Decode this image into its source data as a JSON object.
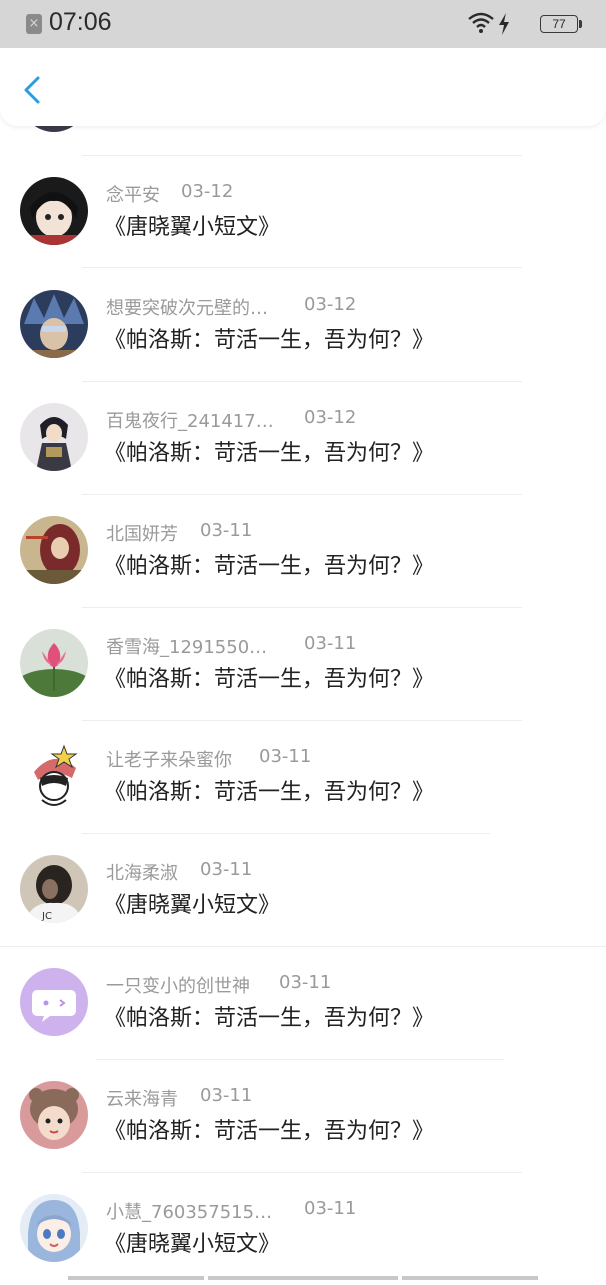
{
  "status_bar": {
    "time": "07:06",
    "battery": "77"
  },
  "header": {
    "back_icon": "chevron-left-icon",
    "accent": "#2a9de0"
  },
  "list": [
    {
      "name": "念平安",
      "date": "03-12",
      "title": "《唐晓翼小短文》"
    },
    {
      "name": "想要突破次元壁的…",
      "date": "03-12",
      "title": "《帕洛斯：苛活一生，吾为何？》"
    },
    {
      "name": "百鬼夜行_241417…",
      "date": "03-12",
      "title": "《帕洛斯：苛活一生，吾为何？》"
    },
    {
      "name": "北国妍芳",
      "date": "03-11",
      "title": "《帕洛斯：苛活一生，吾为何？》"
    },
    {
      "name": "香雪海_1291550…",
      "date": "03-11",
      "title": "《帕洛斯：苛活一生，吾为何？》"
    },
    {
      "name": "让老子来朵蜜你",
      "date": "03-11",
      "title": "《帕洛斯：苛活一生，吾为何？》"
    },
    {
      "name": "北海柔淑",
      "date": "03-11",
      "title": "《唐晓翼小短文》"
    },
    {
      "name": "一只变小的创世神",
      "date": "03-11",
      "title": "《帕洛斯：苛活一生，吾为何？》"
    },
    {
      "name": "云来海青",
      "date": "03-11",
      "title": "《帕洛斯：苛活一生，吾为何？》"
    },
    {
      "name": "小慧_760357515…",
      "date": "03-11",
      "title": "《唐晓翼小短文》"
    }
  ]
}
